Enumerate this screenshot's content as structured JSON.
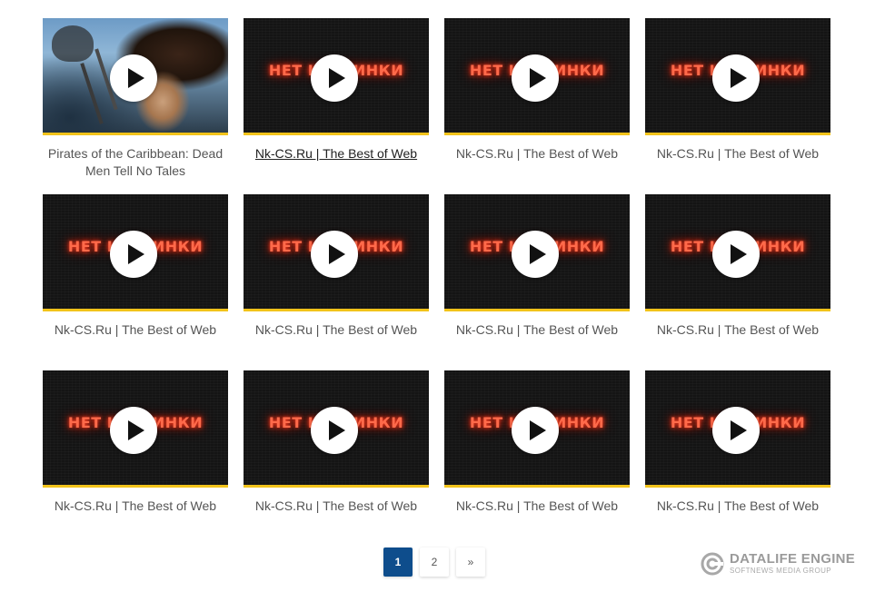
{
  "colors": {
    "accent_underline": "#f2c31a",
    "pager_active": "#0e4d8c",
    "title_text": "#555555",
    "noimage_glow": "#ff6a4a"
  },
  "noimage_label": "НЕТ КАРТИНКИ",
  "cards": [
    {
      "title": "Pirates of the Caribbean: Dead Men Tell No Tales",
      "thumb": "poster",
      "icon": "play-icon"
    },
    {
      "title": "Nk-CS.Ru | The Best of Web",
      "thumb": "no-image",
      "icon": "play-icon",
      "state": "hover"
    },
    {
      "title": "Nk-CS.Ru | The Best of Web",
      "thumb": "no-image",
      "icon": "play-icon"
    },
    {
      "title": "Nk-CS.Ru | The Best of Web",
      "thumb": "no-image",
      "icon": "play-icon"
    },
    {
      "title": "Nk-CS.Ru | The Best of Web",
      "thumb": "no-image",
      "icon": "play-icon"
    },
    {
      "title": "Nk-CS.Ru | The Best of Web",
      "thumb": "no-image",
      "icon": "play-icon"
    },
    {
      "title": "Nk-CS.Ru | The Best of Web",
      "thumb": "no-image",
      "icon": "play-icon"
    },
    {
      "title": "Nk-CS.Ru | The Best of Web",
      "thumb": "no-image",
      "icon": "play-icon"
    },
    {
      "title": "Nk-CS.Ru | The Best of Web",
      "thumb": "no-image",
      "icon": "play-icon"
    },
    {
      "title": "Nk-CS.Ru | The Best of Web",
      "thumb": "no-image",
      "icon": "play-icon"
    },
    {
      "title": "Nk-CS.Ru | The Best of Web",
      "thumb": "no-image",
      "icon": "play-icon"
    },
    {
      "title": "Nk-CS.Ru | The Best of Web",
      "thumb": "no-image",
      "icon": "play-icon"
    }
  ],
  "pagination": {
    "pages": [
      "1",
      "2"
    ],
    "current": "1",
    "next_label": "»"
  },
  "brand": {
    "name": "DATALIFE ENGINE",
    "subtitle": "SOFTNEWS MEDIA GROUP",
    "icon": "datalife-logo-icon"
  }
}
